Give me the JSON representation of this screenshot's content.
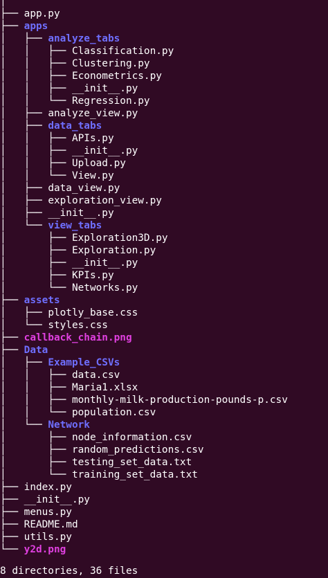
{
  "terminal": {
    "background": "#300a24",
    "colors": {
      "file": "#ffffff",
      "directory": "#6f6fff",
      "image": "#e040e0"
    },
    "tree": [
      {
        "prefix": "│",
        "name": "",
        "kind": "file"
      },
      {
        "prefix": "├── ",
        "name": "app.py",
        "kind": "file"
      },
      {
        "prefix": "├── ",
        "name": "apps",
        "kind": "dir"
      },
      {
        "prefix": "│   ├── ",
        "name": "analyze_tabs",
        "kind": "dir"
      },
      {
        "prefix": "│   │   ├── ",
        "name": "Classification.py",
        "kind": "file"
      },
      {
        "prefix": "│   │   ├── ",
        "name": "Clustering.py",
        "kind": "file"
      },
      {
        "prefix": "│   │   ├── ",
        "name": "Econometrics.py",
        "kind": "file"
      },
      {
        "prefix": "│   │   ├── ",
        "name": "__init__.py",
        "kind": "file"
      },
      {
        "prefix": "│   │   └── ",
        "name": "Regression.py",
        "kind": "file"
      },
      {
        "prefix": "│   ├── ",
        "name": "analyze_view.py",
        "kind": "file"
      },
      {
        "prefix": "│   ├── ",
        "name": "data_tabs",
        "kind": "dir"
      },
      {
        "prefix": "│   │   ├── ",
        "name": "APIs.py",
        "kind": "file"
      },
      {
        "prefix": "│   │   ├── ",
        "name": "__init__.py",
        "kind": "file"
      },
      {
        "prefix": "│   │   ├── ",
        "name": "Upload.py",
        "kind": "file"
      },
      {
        "prefix": "│   │   └── ",
        "name": "View.py",
        "kind": "file"
      },
      {
        "prefix": "│   ├── ",
        "name": "data_view.py",
        "kind": "file"
      },
      {
        "prefix": "│   ├── ",
        "name": "exploration_view.py",
        "kind": "file"
      },
      {
        "prefix": "│   ├── ",
        "name": "__init__.py",
        "kind": "file"
      },
      {
        "prefix": "│   └── ",
        "name": "view_tabs",
        "kind": "dir"
      },
      {
        "prefix": "│       ├── ",
        "name": "Exploration3D.py",
        "kind": "file"
      },
      {
        "prefix": "│       ├── ",
        "name": "Exploration.py",
        "kind": "file"
      },
      {
        "prefix": "│       ├── ",
        "name": "__init__.py",
        "kind": "file"
      },
      {
        "prefix": "│       ├── ",
        "name": "KPIs.py",
        "kind": "file"
      },
      {
        "prefix": "│       └── ",
        "name": "Networks.py",
        "kind": "file"
      },
      {
        "prefix": "├── ",
        "name": "assets",
        "kind": "dir"
      },
      {
        "prefix": "│   ├── ",
        "name": "plotly_base.css",
        "kind": "file"
      },
      {
        "prefix": "│   └── ",
        "name": "styles.css",
        "kind": "file"
      },
      {
        "prefix": "├── ",
        "name": "callback_chain.png",
        "kind": "img"
      },
      {
        "prefix": "├── ",
        "name": "Data",
        "kind": "dir"
      },
      {
        "prefix": "│   ├── ",
        "name": "Example_CSVs",
        "kind": "dir"
      },
      {
        "prefix": "│   │   ├── ",
        "name": "data.csv",
        "kind": "file"
      },
      {
        "prefix": "│   │   ├── ",
        "name": "Maria1.xlsx",
        "kind": "file"
      },
      {
        "prefix": "│   │   ├── ",
        "name": "monthly-milk-production-pounds-p.csv",
        "kind": "file"
      },
      {
        "prefix": "│   │   └── ",
        "name": "population.csv",
        "kind": "file"
      },
      {
        "prefix": "│   └── ",
        "name": "Network",
        "kind": "dir"
      },
      {
        "prefix": "│       ├── ",
        "name": "node_information.csv",
        "kind": "file"
      },
      {
        "prefix": "│       ├── ",
        "name": "random_predictions.csv",
        "kind": "file"
      },
      {
        "prefix": "│       ├── ",
        "name": "testing_set_data.txt",
        "kind": "file"
      },
      {
        "prefix": "│       └── ",
        "name": "training_set_data.txt",
        "kind": "file"
      },
      {
        "prefix": "├── ",
        "name": "index.py",
        "kind": "file"
      },
      {
        "prefix": "├── ",
        "name": "__init__.py",
        "kind": "file"
      },
      {
        "prefix": "├── ",
        "name": "menus.py",
        "kind": "file"
      },
      {
        "prefix": "├── ",
        "name": "README.md",
        "kind": "file"
      },
      {
        "prefix": "├── ",
        "name": "utils.py",
        "kind": "file"
      },
      {
        "prefix": "└── ",
        "name": "y2d.png",
        "kind": "img"
      }
    ],
    "summary": "8 directories, 36 files"
  }
}
